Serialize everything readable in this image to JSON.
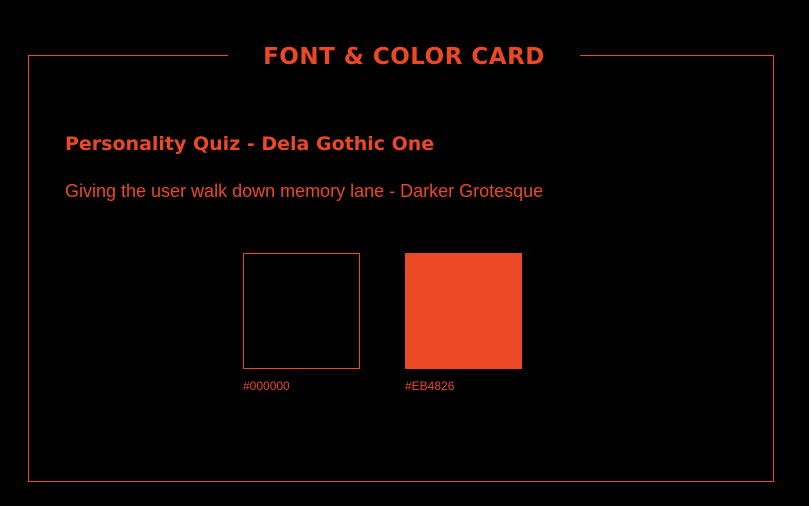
{
  "card": {
    "title": "FONT & COLOR CARD",
    "accent_color": "#EB4826",
    "background_color": "#000000"
  },
  "fonts": {
    "heading_sample": "Personality Quiz - Dela Gothic One",
    "body_sample": "Giving the user walk down memory lane - Darker Grotesque"
  },
  "swatches": [
    {
      "hex": "#000000",
      "label": "#000000"
    },
    {
      "hex": "#EB4826",
      "label": "#EB4826"
    }
  ]
}
